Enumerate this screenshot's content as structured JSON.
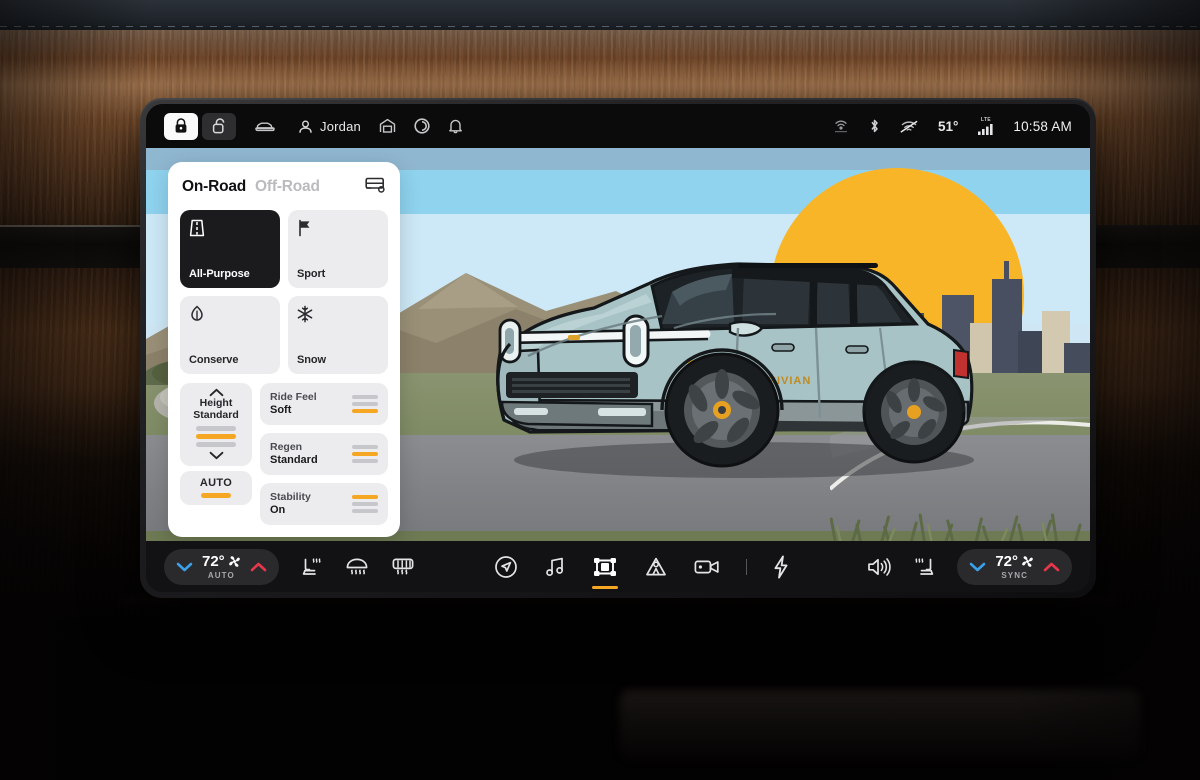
{
  "statusbar": {
    "lock_locked_icon": "lock-closed-icon",
    "lock_unlocked_icon": "lock-open-icon",
    "car_icon": "car-icon",
    "profile_icon": "person-icon",
    "profile_name": "Jordan",
    "garage_icon": "garage-icon",
    "assistant_icon": "assistant-ring-icon",
    "bell_icon": "bell-icon",
    "wireless_icon": "broadcast-icon",
    "bluetooth_icon": "bluetooth-icon",
    "wifi_off_icon": "wifi-off-icon",
    "outside_temp": "51°",
    "lte_label": "LTE",
    "signal_icon": "cellular-bars-icon",
    "time": "10:58 AM"
  },
  "panel": {
    "tab_onroad": "On-Road",
    "tab_offroad": "Off-Road",
    "tow_icon": "trailer-tow-icon",
    "modes": [
      {
        "label": "All-Purpose",
        "icon": "road-icon",
        "selected": true
      },
      {
        "label": "Sport",
        "icon": "flag-icon",
        "selected": false
      },
      {
        "label": "Conserve",
        "icon": "leaf-icon",
        "selected": false
      },
      {
        "label": "Snow",
        "icon": "snowflake-icon",
        "selected": false
      }
    ],
    "height": {
      "label_line1": "Height",
      "label_line2": "Standard",
      "up_icon": "chevron-up-icon",
      "down_icon": "chevron-down-icon",
      "segments": [
        "off",
        "on",
        "off"
      ]
    },
    "auto": {
      "label": "AUTO",
      "active": true
    },
    "settings": [
      {
        "name": "Ride Feel",
        "value": "Soft",
        "segments": [
          "off",
          "off",
          "on"
        ]
      },
      {
        "name": "Regen",
        "value": "Standard",
        "segments": [
          "off",
          "on",
          "off"
        ]
      },
      {
        "name": "Stability",
        "value": "On",
        "segments": [
          "on",
          "off",
          "off"
        ]
      }
    ]
  },
  "bottombar": {
    "left_climate": {
      "down_icon": "chevron-down-icon",
      "temp": "72°",
      "fan_icon": "fan-icon",
      "up_icon": "chevron-up-icon",
      "sub": "AUTO"
    },
    "left_icons": [
      {
        "name": "heated-seat-icon"
      },
      {
        "name": "front-defrost-icon"
      },
      {
        "name": "rear-defrost-icon"
      }
    ],
    "center_nav": [
      {
        "name": "navigation-icon",
        "active": false
      },
      {
        "name": "music-icon",
        "active": false
      },
      {
        "name": "drive-mode-chassis-icon",
        "active": true
      },
      {
        "name": "camping-gear-icon",
        "active": false
      },
      {
        "name": "camera-icon",
        "active": false
      },
      {
        "name": "divider",
        "active": false
      },
      {
        "name": "charging-bolt-icon",
        "active": false
      }
    ],
    "right_icons": [
      {
        "name": "volume-icon"
      },
      {
        "name": "heated-seat-icon"
      }
    ],
    "right_climate": {
      "down_icon": "chevron-down-icon",
      "temp": "72°",
      "fan_icon": "fan-icon",
      "up_icon": "chevron-up-icon",
      "sub": "SYNC"
    }
  },
  "scene": {
    "description": "Illustrated Rivian R1S electric SUV on a road with wind turbine, mountains, setting sun, and city skyline",
    "vehicle_color": "#a8c3c6",
    "sun_color": "#f9b528",
    "sky_color": "#8fd3ef"
  },
  "theme": {
    "accent_orange": "#f5a623",
    "panel_white": "#ffffff",
    "chip_gray": "#ececee",
    "selected_dark": "#1b1b1d",
    "bar_dark": "#121214",
    "blue_arrow": "#3aa0e8",
    "red_arrow": "#e8374a"
  }
}
